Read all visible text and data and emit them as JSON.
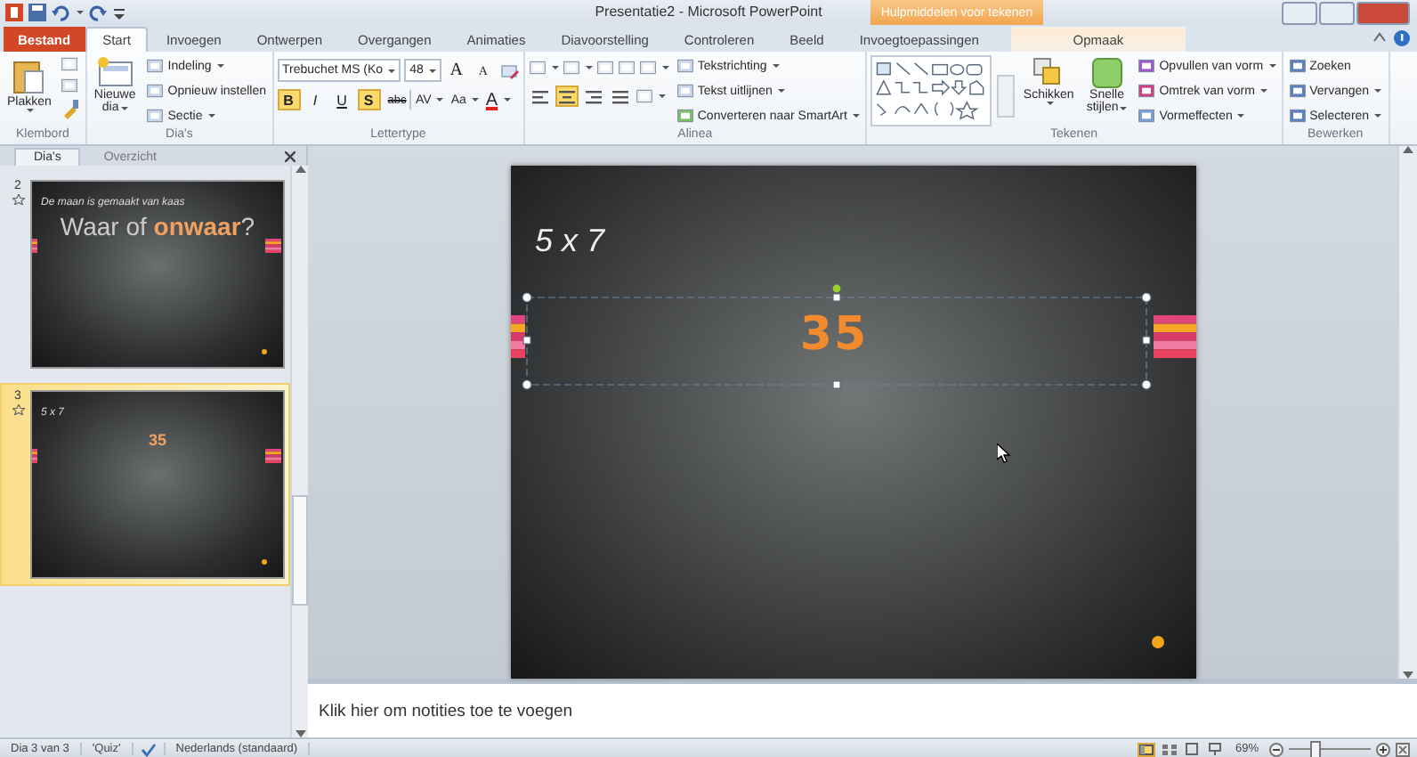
{
  "window": {
    "title": "Presentatie2 - Microsoft PowerPoint"
  },
  "contextual": {
    "label": "Hulpmiddelen voor tekenen"
  },
  "ribbon_tabs": [
    {
      "label": "Bestand",
      "kind": "file",
      "selected": false
    },
    {
      "label": "Start",
      "kind": "normal",
      "selected": true
    },
    {
      "label": "Invoegen",
      "kind": "normal",
      "selected": false
    },
    {
      "label": "Ontwerpen",
      "kind": "normal",
      "selected": false
    },
    {
      "label": "Overgangen",
      "kind": "normal",
      "selected": false
    },
    {
      "label": "Animaties",
      "kind": "normal",
      "selected": false
    },
    {
      "label": "Diavoorstelling",
      "kind": "normal",
      "selected": false
    },
    {
      "label": "Controleren",
      "kind": "normal",
      "selected": false
    },
    {
      "label": "Beeld",
      "kind": "normal",
      "selected": false
    },
    {
      "label": "Invoegtoepassingen",
      "kind": "normal",
      "selected": false
    },
    {
      "label": "Opmaak",
      "kind": "contextual",
      "selected": false
    }
  ],
  "groups": [
    {
      "kind": "clipboard",
      "label": "Klembord",
      "paste": "Plakken"
    },
    {
      "kind": "slides",
      "label": "Dia's",
      "new_slide": [
        "Nieuwe",
        "dia"
      ],
      "commands": [
        "Indeling",
        "Opnieuw instellen",
        "Sectie"
      ]
    },
    {
      "kind": "font",
      "label": "Lettertype",
      "font": "Trebuchet MS (Ko",
      "size": "48",
      "grow": "A",
      "shrink": "A",
      "toggles": [
        {
          "label": "B",
          "selected": true
        },
        {
          "label": "I",
          "selected": false
        },
        {
          "label": "U",
          "selected": false
        },
        {
          "label": "S",
          "selected": true
        },
        {
          "label": "abc",
          "selected": false
        }
      ],
      "tools": [
        "AV",
        "Aa"
      ],
      "color_letter": "A"
    },
    {
      "kind": "paragraph",
      "label": "Alinea",
      "aligns": [
        {
          "selected": false
        },
        {
          "selected": true
        },
        {
          "selected": false
        },
        {
          "selected": false
        }
      ],
      "commands": [
        "Tekstrichting",
        "Tekst uitlijnen",
        "Converteren naar SmartArt"
      ]
    },
    {
      "kind": "drawing",
      "label": "Tekenen",
      "arrange": "Schikken",
      "quick_styles": [
        "Snelle",
        "stijlen"
      ],
      "commands": [
        "Opvullen van vorm",
        "Omtrek van vorm",
        "Vormeffecten"
      ]
    },
    {
      "kind": "editing",
      "label": "Bewerken",
      "commands": [
        "Zoeken",
        "Vervangen",
        "Selecteren"
      ]
    }
  ],
  "pane_tabs": [
    {
      "label": "Dia's",
      "selected": true
    },
    {
      "label": "Overzicht",
      "selected": false
    }
  ],
  "thumbnails": [
    {
      "number": "2",
      "selected": false,
      "title": "De maan is gemaakt van kaas",
      "heading": "Waar of **onwaar**?"
    },
    {
      "number": "3",
      "selected": true,
      "title": "5 x 7",
      "heading": "**35**"
    }
  ],
  "slide": {
    "title": "5 x 7",
    "answer": "35"
  },
  "notes": {
    "placeholder": "Klik hier om notities toe te voegen"
  },
  "status_bar": {
    "slide": "Dia 3 van 3",
    "theme": "'Quiz'",
    "language": "Nederlands (standaard)",
    "zoom": "69%",
    "zoom_level": {
      "level": 0.3
    }
  }
}
